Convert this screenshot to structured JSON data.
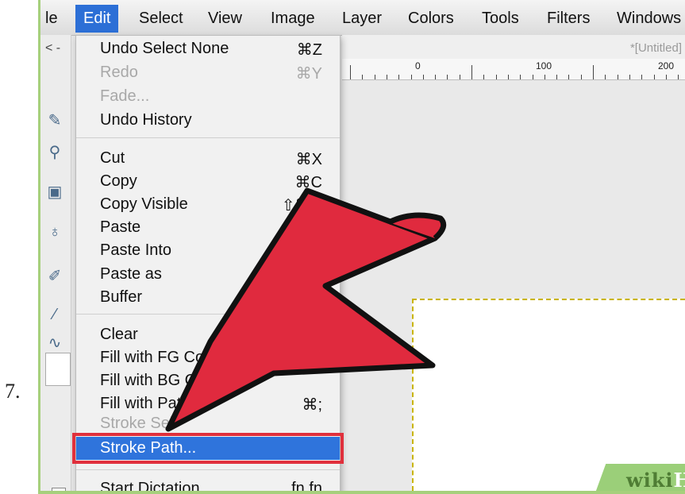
{
  "step": "7.",
  "menubar": {
    "items": [
      {
        "label": "le"
      },
      {
        "label": "Edit"
      },
      {
        "label": "Select"
      },
      {
        "label": "View"
      },
      {
        "label": "Image"
      },
      {
        "label": "Layer"
      },
      {
        "label": "Colors"
      },
      {
        "label": "Tools"
      },
      {
        "label": "Filters"
      },
      {
        "label": "Windows"
      }
    ]
  },
  "left_tab": "< - ",
  "document": {
    "title": "*[Untitled]"
  },
  "ruler": {
    "labels": [
      "0",
      "100",
      "200"
    ]
  },
  "edit_menu": {
    "items": [
      {
        "label": "Undo Select None",
        "shortcut": "⌘Z",
        "enabled": true
      },
      {
        "label": "Redo",
        "shortcut": "⌘Y",
        "enabled": false
      },
      {
        "label": "Fade...",
        "shortcut": "",
        "enabled": false
      },
      {
        "label": "Undo History",
        "shortcut": "",
        "enabled": true
      },
      {
        "label": "Cut",
        "shortcut": "⌘X",
        "enabled": true
      },
      {
        "label": "Copy",
        "shortcut": "⌘C",
        "enabled": true
      },
      {
        "label": "Copy Visible",
        "shortcut": "⇧⌘C",
        "enabled": true
      },
      {
        "label": "Paste",
        "shortcut": "",
        "enabled": true
      },
      {
        "label": "Paste Into",
        "shortcut": "",
        "enabled": true
      },
      {
        "label": "Paste as",
        "shortcut": "",
        "enabled": true
      },
      {
        "label": "Buffer",
        "shortcut": "",
        "enabled": true
      },
      {
        "label": "Clear",
        "shortcut": "",
        "enabled": true
      },
      {
        "label": "Fill with FG Co",
        "shortcut": "",
        "enabled": true
      },
      {
        "label": "Fill with BG C",
        "shortcut": "",
        "enabled": true
      },
      {
        "label": "Fill with Pat",
        "shortcut": "⌘;",
        "enabled": true
      },
      {
        "label": "Stroke Sel",
        "shortcut": "",
        "enabled": false
      },
      {
        "label": "Stroke Path...",
        "shortcut": "",
        "enabled": true,
        "highlighted": true
      },
      {
        "label": "Start Dictation",
        "shortcut": "fn fn",
        "enabled": true
      }
    ]
  },
  "watermark": {
    "part1": "wiki",
    "part2": "How"
  },
  "colors": {
    "accent": "#2f74dc",
    "highlight_border": "#e0303c",
    "arrow": "#e02a3e",
    "watermark_bg": "#9bcf79"
  }
}
